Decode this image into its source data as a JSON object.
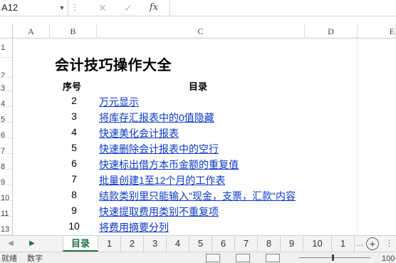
{
  "formula_bar": {
    "name_box": "A12",
    "dots": "⋮",
    "cancel_icon": "✕",
    "enter_icon": "✓",
    "fx_label": "fx",
    "formula": ""
  },
  "columns": [
    "A",
    "B",
    "C",
    "D",
    "E"
  ],
  "rows": [
    "1",
    "2",
    "3",
    "4",
    "5",
    "6",
    "7",
    "8",
    "9",
    "10",
    "11",
    "12",
    "13"
  ],
  "sheet": {
    "title": "会计技巧操作大全",
    "header_no": "序号",
    "header_toc": "目录",
    "entries": [
      {
        "no": "2",
        "text": "万元显示"
      },
      {
        "no": "3",
        "text": "将库存汇报表中的0值隐藏"
      },
      {
        "no": "4",
        "text": "快速美化会计报表"
      },
      {
        "no": "5",
        "text": "快速删除会计报表中的空行"
      },
      {
        "no": "6",
        "text": "快速标出借方本币金额的重复值"
      },
      {
        "no": "7",
        "text": "批量创建1至12个月的工作表"
      },
      {
        "no": "8",
        "text": "结款类别里只能输入\"现金，支票，汇款\"内容"
      },
      {
        "no": "9",
        "text": "快速提取费用类别不重复项"
      },
      {
        "no": "10",
        "text": "将费用摘要分列"
      }
    ]
  },
  "tabs": {
    "nav_prev": "◀",
    "nav_next": "▶",
    "active": "目录",
    "items": [
      "1",
      "2",
      "3",
      "4",
      "5",
      "6",
      "7",
      "8",
      "9",
      "10",
      "1"
    ],
    "more": "...",
    "add": "+",
    "scroll": "⋮"
  },
  "status": {
    "ready": "就绪",
    "numlock": "数字",
    "zoom": "100"
  }
}
